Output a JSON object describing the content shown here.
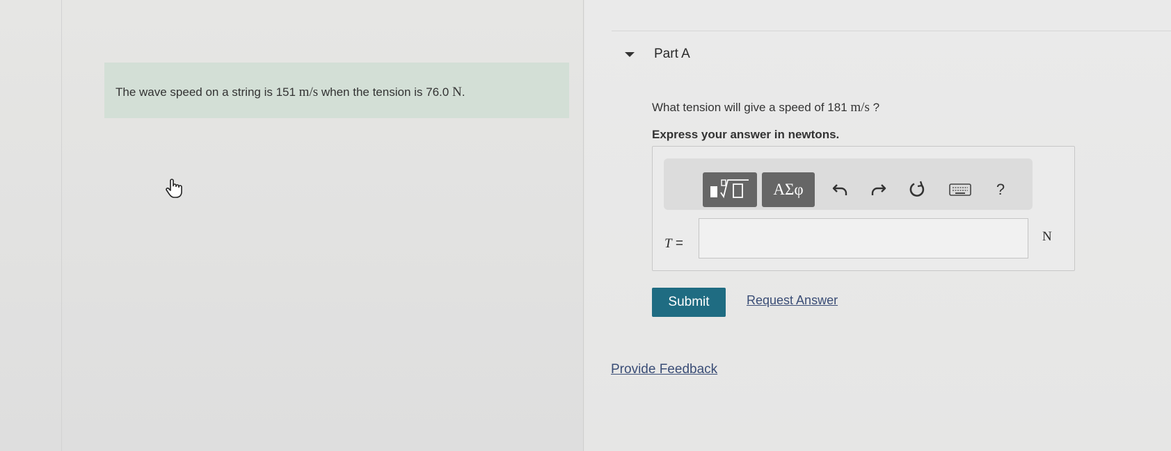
{
  "problem": {
    "text_before_speed": "The wave speed on a string is 151",
    "speed_unit": "m/s",
    "text_middle": "when the tension is 76.0",
    "tension_unit": "N",
    "text_end": "."
  },
  "part": {
    "title": "Part A",
    "question_before": "What tension will give a speed of 181",
    "question_unit": "m/s",
    "question_end": "?",
    "instruction": "Express your answer in newtons."
  },
  "toolbar": {
    "symbols_label": "ΑΣφ",
    "help_label": "?"
  },
  "answer": {
    "variable": "T",
    "equals": "=",
    "value": "",
    "unit": "N"
  },
  "actions": {
    "submit_label": "Submit",
    "request_answer_label": "Request Answer"
  },
  "footer": {
    "feedback_label": "Provide Feedback"
  },
  "colors": {
    "problem_background": "#d3dfd6",
    "submit_background": "#1f6c82",
    "link_color": "#3a4d76",
    "toolbar_button": "#666666"
  }
}
